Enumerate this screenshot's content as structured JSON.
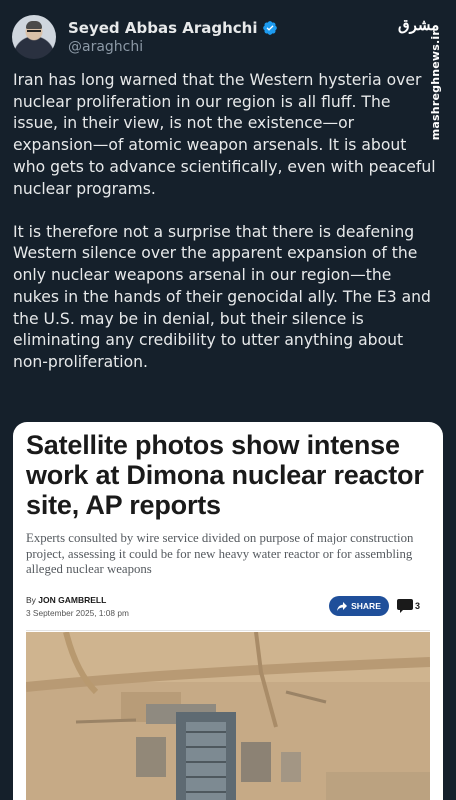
{
  "author": {
    "display_name": "Seyed Abbas Araghchi",
    "handle": "@araghchi",
    "verified": true,
    "verified_icon": "verified-badge-icon"
  },
  "watermark": {
    "logo_text": "مشرق",
    "url": "mashreghnews.ir"
  },
  "tweet": {
    "paragraphs": [
      "Iran has long warned that the Western hysteria over nuclear proliferation in our region is all fluff. The issue, in their view, is not the existence—or expansion—of atomic weapon arsenals. It is about who gets to advance scientifically, even with peaceful nuclear programs.",
      "It is therefore not a surprise that there is deafening Western silence over the apparent expansion of the only nuclear weapons arsenal in our region—the nukes in the hands of their genocidal ally. The E3 and the U.S. may be in denial, but their silence is eliminating any credibility to utter anything about non-proliferation."
    ]
  },
  "article": {
    "headline": "Satellite photos show intense work at Dimona nuclear reactor site, AP reports",
    "subhead": "Experts consulted by wire service divided on purpose of major construction project, assessing it could be for new heavy water reactor or for assembling alleged nuclear weapons",
    "byline_prefix": "By ",
    "byline_author": "JON GAMBRELL",
    "date": "3 September 2025, 1:08 pm",
    "share_label": "SHARE",
    "comment_count": "3"
  },
  "colors": {
    "background": "#15202b",
    "text": "#e7e9ea",
    "handle": "#8b98a5",
    "verified": "#1d9bf0",
    "share_button": "#1f4f9a"
  }
}
